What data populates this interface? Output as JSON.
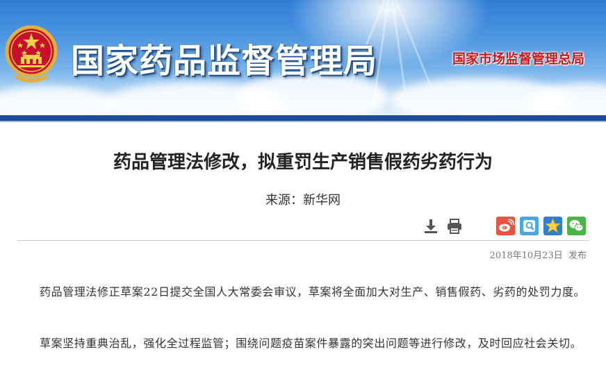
{
  "header": {
    "site_title": "国家药品监督管理局",
    "parent_org": "国家市场监督管理总局"
  },
  "article": {
    "title": "药品管理法修改，拟重罚生产销售假药劣药行为",
    "source": "来源：新华网",
    "publish_date": "2018年10月23日",
    "publish_suffix": "发布",
    "paragraphs": [
      "药品管理法修正草案22日提交全国人大常委会审议，草案将全面加大对生产、销售假药、劣药的处罚力度。",
      "草案坚持重典治乱，强化全过程监管；围绕问题疫苗案件暴露的突出问题等进行修改，及时回应社会关切。"
    ]
  },
  "toolbar": {
    "download_icon": "download-icon",
    "print_icon": "print-icon"
  },
  "share_buttons": [
    {
      "name": "weibo-icon",
      "color": "#e8533f"
    },
    {
      "name": "qzone-icon",
      "color": "#4aa7e6"
    },
    {
      "name": "favorite-star-icon",
      "color": "#2f7fd1"
    },
    {
      "name": "wechat-icon",
      "color": "#49b549"
    }
  ]
}
